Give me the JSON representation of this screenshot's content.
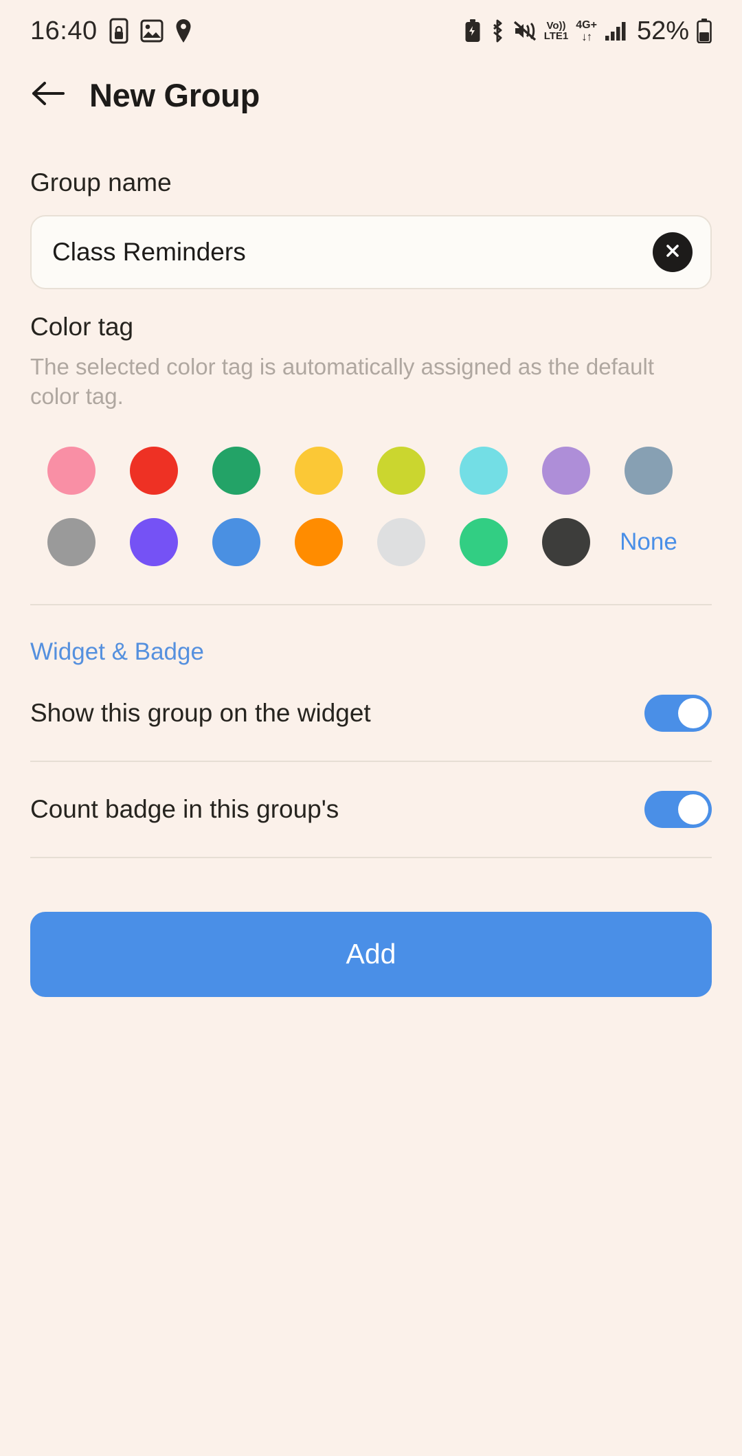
{
  "status_bar": {
    "time": "16:40",
    "battery_percent": "52%",
    "network_label_top": "Vo))",
    "network_label_bottom": "LTE1",
    "data_label": "4G+",
    "data_arrows": "↓↑",
    "icons": [
      "phone-lock-icon",
      "gallery-image-icon",
      "location-pin-icon",
      "battery-saver-icon",
      "bluetooth-icon",
      "sound-mute-icon",
      "volte-icon",
      "signal-bars-icon",
      "battery-icon"
    ]
  },
  "header": {
    "back_icon": "arrow-left-icon",
    "title": "New Group"
  },
  "group_name": {
    "label": "Group name",
    "value": "Class Reminders",
    "placeholder": "Group name",
    "clear_icon": "close-circle-icon"
  },
  "color_tag": {
    "title": "Color tag",
    "description": "The selected color tag is automatically assigned as the default color tag.",
    "none_label": "None",
    "rows": [
      [
        {
          "name": "pink",
          "hex": "#F98FA5"
        },
        {
          "name": "red",
          "hex": "#EE3124"
        },
        {
          "name": "green",
          "hex": "#23A367"
        },
        {
          "name": "yellow",
          "hex": "#FBC836"
        },
        {
          "name": "lime",
          "hex": "#CBD62F"
        },
        {
          "name": "cyan",
          "hex": "#73DEE5"
        },
        {
          "name": "purple",
          "hex": "#AE8ED8"
        },
        {
          "name": "slate",
          "hex": "#87A0B3"
        }
      ],
      [
        {
          "name": "gray",
          "hex": "#9A9A9A"
        },
        {
          "name": "violet",
          "hex": "#7552F5"
        },
        {
          "name": "blue",
          "hex": "#4A90E2"
        },
        {
          "name": "orange",
          "hex": "#FF8C00"
        },
        {
          "name": "light-gray",
          "hex": "#DEDFE0"
        },
        {
          "name": "emerald",
          "hex": "#32CE83"
        },
        {
          "name": "charcoal",
          "hex": "#3D3D3B"
        }
      ]
    ]
  },
  "widget_badge": {
    "header": "Widget & Badge",
    "rows": [
      {
        "label": "Show this group on the widget",
        "enabled": true
      },
      {
        "label": "Count badge in this group's",
        "enabled": true
      }
    ]
  },
  "primary_action": {
    "label": "Add"
  },
  "theme": {
    "background": "#FBF1EA",
    "accent": "#4A8FE7",
    "text": "#26241F",
    "muted_text": "#AFA7A0"
  }
}
